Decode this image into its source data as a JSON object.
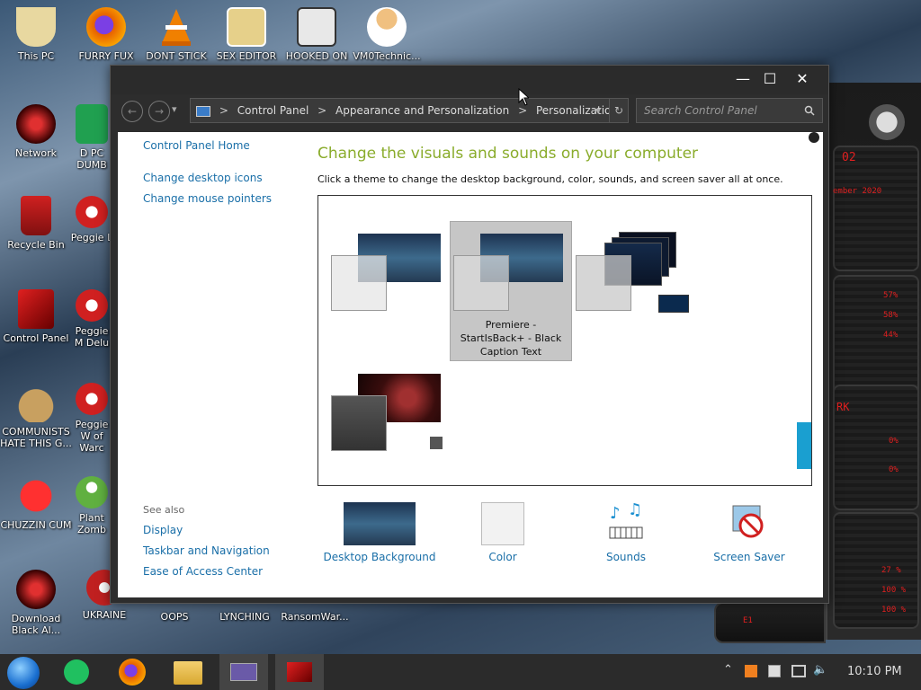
{
  "desktop": {
    "icons": [
      {
        "label": "This PC",
        "icon": "folder-bird-icon",
        "color": "#e8d8a0"
      },
      {
        "label": "FURRY FUX",
        "icon": "firefox-icon",
        "color": "#e66000"
      },
      {
        "label": "DONT STICK",
        "icon": "vlc-cone-icon",
        "color": "#f08000"
      },
      {
        "label": "SEX EDITOR",
        "icon": "hxd-icon",
        "color": "#d8a040"
      },
      {
        "label": "HOOKED ON",
        "icon": "hook-icon",
        "color": "#303030"
      },
      {
        "label": "VM0Technic...",
        "icon": "doctor-icon",
        "color": "#f0c080"
      },
      {
        "label": "Network",
        "icon": "network-red-icon",
        "color": "#b01010"
      },
      {
        "label": "D PC DUMB",
        "icon": "green-app-icon",
        "color": "#20a050"
      },
      {
        "label": "Recycle Bin",
        "icon": "recycle-bin-icon",
        "color": "#cc2222"
      },
      {
        "label": "Peggie L",
        "icon": "peggie-icon",
        "color": "#d02020"
      },
      {
        "label": "Control Panel",
        "icon": "control-panel-icon",
        "color": "#c01818"
      },
      {
        "label": "Peggie M Delu",
        "icon": "peggie-icon",
        "color": "#d02020"
      },
      {
        "label": "COMMUNISTS HATE THIS G...",
        "icon": "money-bag-icon",
        "color": "#c8a060"
      },
      {
        "label": "Peggie W of Warc",
        "icon": "peggie-icon",
        "color": "#d02020"
      },
      {
        "label": "CHUZZIN CUM",
        "icon": "chuzzle-icon",
        "color": "#e02020"
      },
      {
        "label": "Plant Zomb",
        "icon": "plant-icon",
        "color": "#60b040"
      },
      {
        "label": "Download Black Al...",
        "icon": "download-red-icon",
        "color": "#b01010"
      },
      {
        "label": "UKRAINE",
        "icon": "ukraine-icon",
        "color": "#c02020"
      },
      {
        "label": "OOPS",
        "icon": "oops-icon",
        "color": "#555555"
      },
      {
        "label": "LYNCHING",
        "icon": "lynching-icon",
        "color": "#555555"
      },
      {
        "label": "RansomWar...",
        "icon": "ransomware-icon",
        "color": "#555555"
      }
    ]
  },
  "widget": {
    "lines": [
      "02",
      "ember 2020",
      "57%",
      "58%",
      "44%",
      "RK",
      "0%",
      "0%",
      "27 %",
      "100 %",
      "100 %",
      "E1"
    ]
  },
  "window": {
    "controls": {
      "minimize": "—",
      "maximize": "☐",
      "close": "✕"
    },
    "address": {
      "back": "←",
      "forward": "→",
      "dropdown": "▾",
      "refresh": "↻",
      "crumbs": [
        "Control Panel",
        "Appearance and Personalization",
        "Personalization"
      ],
      "separator": ">",
      "search_placeholder": "Search Control Panel"
    },
    "sidebar": {
      "home": "Control Panel Home",
      "links": [
        "Change desktop icons",
        "Change mouse pointers"
      ],
      "see_also_title": "See also",
      "see_also": [
        "Display",
        "Taskbar and Navigation",
        "Ease of Access Center"
      ]
    },
    "main": {
      "heading": "Change the visuals and sounds on your computer",
      "description": "Click a theme to change the desktop background, color, sounds, and screen saver all at once.",
      "selected_theme_label": "Premiere - StartIsBack+ - Black Caption Text"
    },
    "bottom": [
      {
        "label": "Desktop Background",
        "icon": "desktop-background-icon"
      },
      {
        "label": "Color",
        "icon": "color-swatch-icon"
      },
      {
        "label": "Sounds",
        "icon": "sounds-icon"
      },
      {
        "label": "Screen Saver",
        "icon": "screen-saver-icon"
      }
    ]
  },
  "taskbar": {
    "clock": "10:10 PM",
    "pinned": [
      "start-orb-icon",
      "notes-icon",
      "firefox-icon",
      "file-explorer-icon",
      "app-window-icon",
      "control-panel-icon"
    ]
  }
}
